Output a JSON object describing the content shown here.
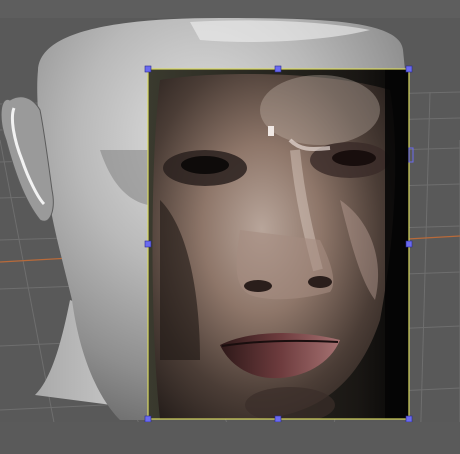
{
  "viewport": {
    "background_color": "#595959",
    "grid_color": "#6b6b6b",
    "x_axis_color": "#b86a3a",
    "selection_color": "#d8d860",
    "handle_color": "#6a6af0"
  },
  "objects": [
    {
      "name": "head-mesh",
      "kind": "3d-model",
      "material": "grey-matte"
    },
    {
      "name": "reference-photo-plane",
      "kind": "image-plane",
      "selected": true
    }
  ]
}
